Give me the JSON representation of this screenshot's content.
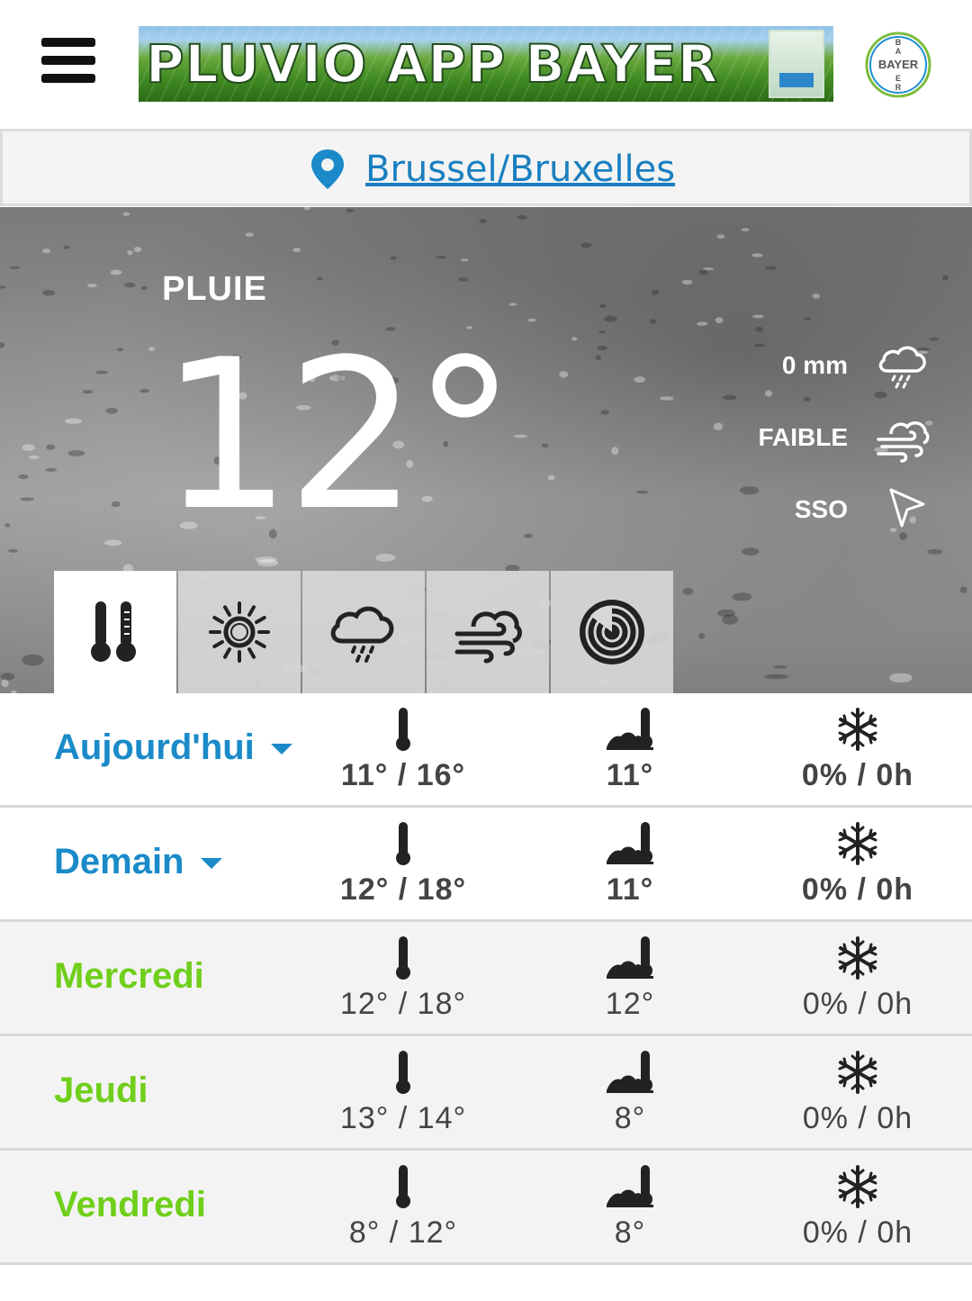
{
  "header": {
    "banner_text": "PLUVIO APP BAYER",
    "logo_text": "BAYER"
  },
  "location": {
    "name": "Brussel/Bruxelles"
  },
  "current": {
    "condition": "PLUIE",
    "temperature": "12°",
    "precipitation": "0 mm",
    "wind_strength": "FAIBLE",
    "wind_direction": "SSO"
  },
  "tabs": [
    {
      "icon": "thermometer-icon",
      "active": true
    },
    {
      "icon": "sun-icon",
      "active": false
    },
    {
      "icon": "rain-cloud-icon",
      "active": false
    },
    {
      "icon": "wind-cloud-icon",
      "active": false
    },
    {
      "icon": "radar-icon",
      "active": false
    }
  ],
  "forecast": [
    {
      "day": "Aujourd'hui",
      "temp_range": "11° / 16°",
      "soil_temp": "11°",
      "frost": "0% / 0h"
    },
    {
      "day": "Demain",
      "temp_range": "12° / 18°",
      "soil_temp": "11°",
      "frost": "0% / 0h"
    },
    {
      "day": "Mercredi",
      "temp_range": "12° / 18°",
      "soil_temp": "12°",
      "frost": "0% / 0h"
    },
    {
      "day": "Jeudi",
      "temp_range": "13° / 14°",
      "soil_temp": "8°",
      "frost": "0% / 0h"
    },
    {
      "day": "Vendredi",
      "temp_range": "8° / 12°",
      "soil_temp": "8°",
      "frost": "0% / 0h"
    }
  ],
  "colors": {
    "link_blue": "#1a7fc0",
    "day_blue": "#1a8ac9",
    "day_green": "#6fcf1a"
  }
}
